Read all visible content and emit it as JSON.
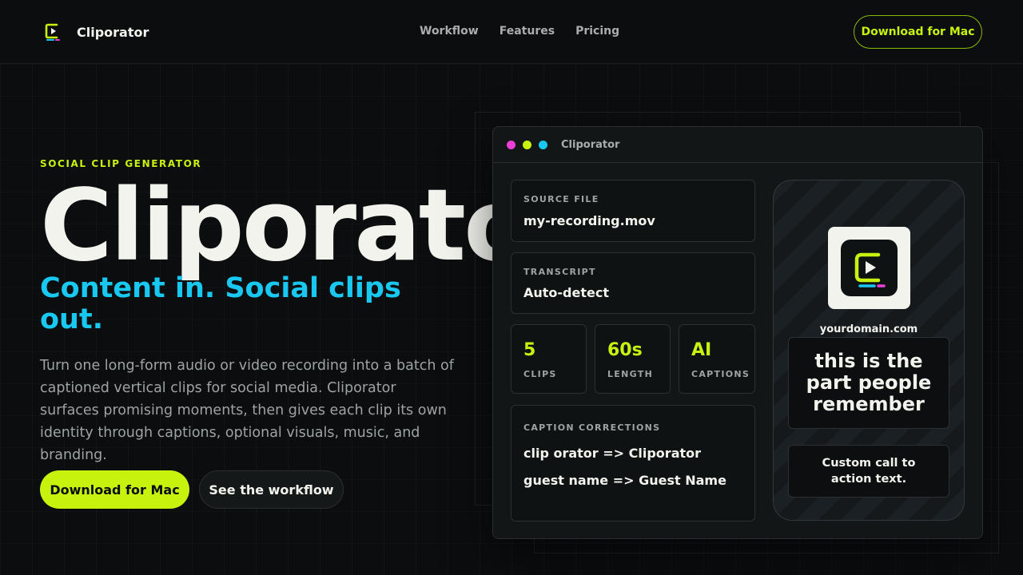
{
  "nav": {
    "brand": "Cliporator",
    "links": [
      "Workflow",
      "Features",
      "Pricing"
    ],
    "cta": "Download for Mac"
  },
  "hero": {
    "eyebrow": "SOCIAL CLIP GENERATOR",
    "title": "Cliporator",
    "subtitle": "Content in. Social clips out.",
    "description": "Turn one long-form audio or video recording into a batch of captioned vertical clips for social media. Cliporator surfaces promising moments, then gives each clip its own identity through captions, optional visuals, music, and branding.",
    "primary_button": "Download for Mac",
    "secondary_button": "See the workflow"
  },
  "app": {
    "window_title": "Cliporator",
    "source": {
      "label": "SOURCE FILE",
      "value": "my-recording.mov"
    },
    "transcript": {
      "label": "TRANSCRIPT",
      "value": "Auto-detect"
    },
    "stats": [
      {
        "value": "5",
        "label": "CLIPS"
      },
      {
        "value": "60s",
        "label": "LENGTH"
      },
      {
        "value": "AI",
        "label": "CAPTIONS"
      }
    ],
    "corrections": {
      "label": "CAPTION CORRECTIONS",
      "items": [
        "clip orator => Cliporator",
        "guest name => Guest Name"
      ]
    },
    "preview": {
      "domain": "yourdomain.com",
      "caption": "this is the part people remember",
      "cta": "Custom call to action text."
    }
  },
  "colors": {
    "accent_lime": "#c6f20e",
    "accent_cyan": "#19c8f0",
    "accent_magenta": "#ec3fd8",
    "background": "#0b0d0e"
  },
  "icons": {
    "brand": "cliporator-logo-icon",
    "preview_logo": "cliporator-logo-icon"
  }
}
